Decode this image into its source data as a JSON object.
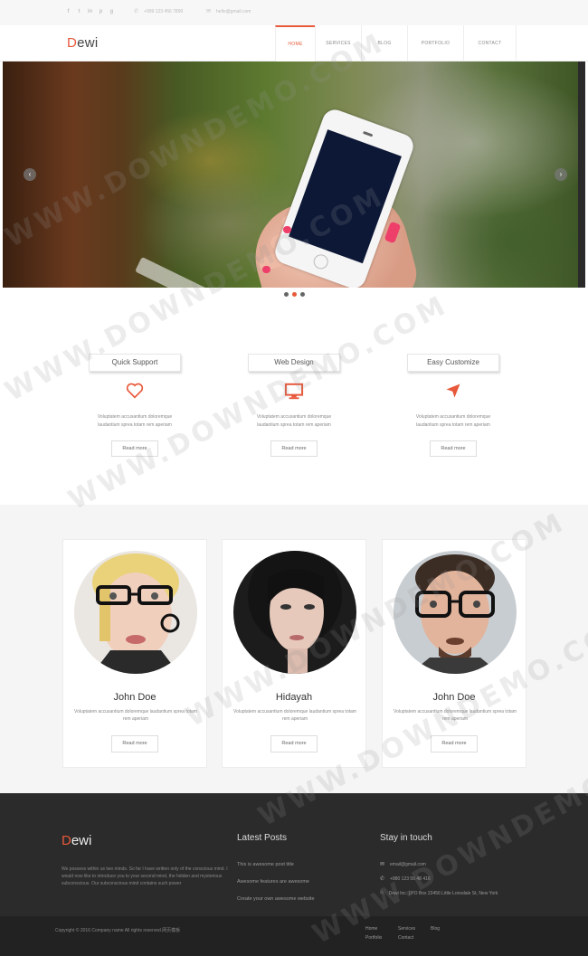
{
  "topbar": {
    "social_icons": [
      "facebook-icon",
      "twitter-icon",
      "linkedin-icon",
      "pinterest-icon",
      "google-plus-icon"
    ],
    "phone": "+999 123 456 7890",
    "email": "hello@gmail.com"
  },
  "header": {
    "logo_first": "D",
    "logo_rest": "ewi",
    "nav": [
      {
        "label": "Home",
        "active": true
      },
      {
        "label": "Services",
        "active": false
      },
      {
        "label": "Blog",
        "active": false
      },
      {
        "label": "Portfolio",
        "active": false
      },
      {
        "label": "Contact",
        "active": false
      }
    ]
  },
  "slider": {
    "prev_arrow": "‹",
    "next_arrow": "›",
    "dots": 3,
    "active_dot": 1
  },
  "features": [
    {
      "title": "Quick Support",
      "icon": "heart-icon",
      "text": "Voluptatem accusantium doloremque laudantium sprea totam rem aperiam",
      "button": "Read more"
    },
    {
      "title": "Web Design",
      "icon": "monitor-icon",
      "text": "Voluptatem accusantium doloremque laudantium sprea totam rem aperiam",
      "button": "Read more"
    },
    {
      "title": "Easy Customize",
      "icon": "location-arrow-icon",
      "text": "Voluptatem accusantium doloremque laudantium sprea totam rem aperiam",
      "button": "Read more"
    }
  ],
  "team": [
    {
      "name": "John Doe",
      "text": "Voluptatem accusantium doloremque laudantium sprea totam rem aperiam",
      "button": "Read more"
    },
    {
      "name": "Hidayah",
      "text": "Voluptatem accusantium doloremque laudantium sprea totam rem aperiam",
      "button": "Read more"
    },
    {
      "name": "John Doe",
      "text": "Voluptatem accusantium doloremque laudantium sprea totam rem aperiam",
      "button": "Read more"
    }
  ],
  "footer": {
    "logo_first": "D",
    "logo_rest": "ewi",
    "about": "We possess within us two minds. So far I have written only of the conscious mind. I would now like to introduce you to your second mind, the hidden and mysterious subconscious. Our subconscious mind contains such power",
    "posts_heading": "Latest Posts",
    "posts": [
      "This is awesome post title",
      "Awesome features are awesome",
      "Create your own awesome website"
    ],
    "contact_heading": "Stay in touch",
    "contact": [
      {
        "icon": "envelope-icon",
        "text": "email@gmail.com"
      },
      {
        "icon": "phone-icon",
        "text": "+880 123 56 48 416"
      },
      {
        "icon": "home-icon",
        "text": "Dewi Inc. | PO Box 23456 Little Lonsdale St, New York"
      }
    ]
  },
  "bottom": {
    "copyright": "Copyright © 2016 Company name All rights reserved.网页模板",
    "links": [
      "Home",
      "Services",
      "Blog",
      "Portfolio",
      "Contact"
    ]
  },
  "watermark": "WWW.DOWNDEMO.COM",
  "colors": {
    "accent": "#e8583a",
    "footer_bg": "#2b2b2b",
    "bottom_bg": "#222222",
    "team_bg": "#f5f5f5"
  }
}
